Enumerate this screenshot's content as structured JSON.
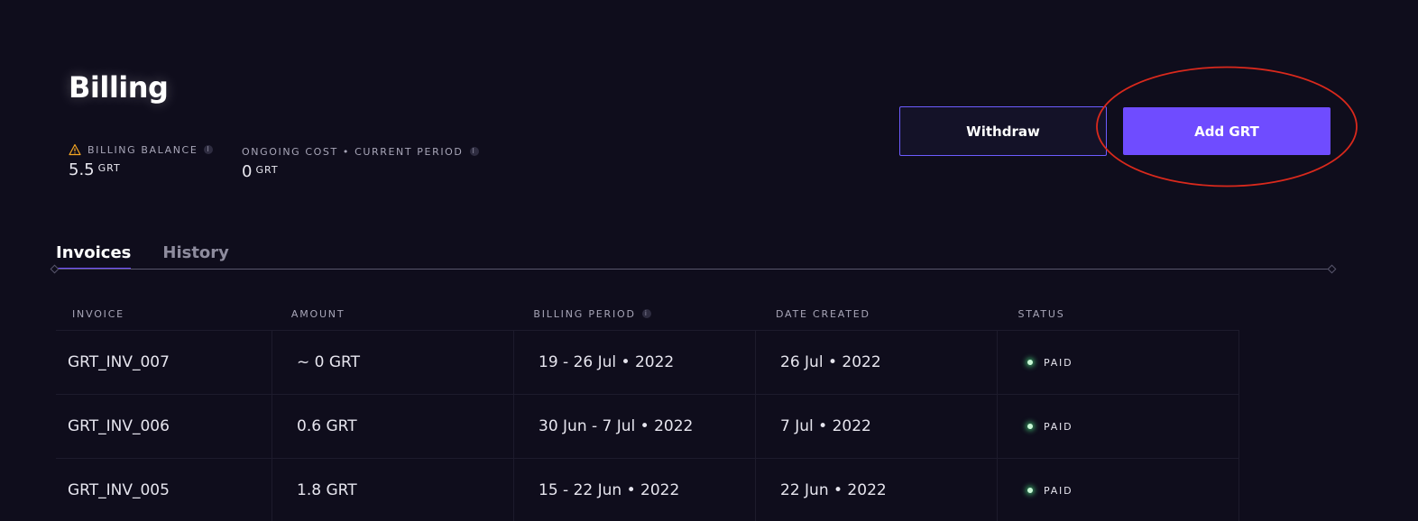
{
  "page": {
    "title": "Billing"
  },
  "stats": {
    "balance": {
      "label": "BILLING BALANCE",
      "value": "5.5",
      "unit": "GRT",
      "icon": "warning-icon"
    },
    "ongoing": {
      "label": "ONGOING COST • CURRENT PERIOD",
      "value": "0",
      "unit": "GRT"
    }
  },
  "actions": {
    "withdraw_label": "Withdraw",
    "add_label": "Add GRT"
  },
  "tabs": [
    {
      "label": "Invoices",
      "active": true
    },
    {
      "label": "History",
      "active": false
    }
  ],
  "table": {
    "headers": [
      "INVOICE",
      "AMOUNT",
      "BILLING PERIOD",
      "DATE CREATED",
      "STATUS"
    ],
    "rows": [
      {
        "invoice": "GRT_INV_007",
        "amount": "~ 0 GRT",
        "period": "19 - 26 Jul • 2022",
        "created": "26 Jul • 2022",
        "status": "PAID"
      },
      {
        "invoice": "GRT_INV_006",
        "amount": "0.6 GRT",
        "period": "30 Jun - 7 Jul • 2022",
        "created": "7 Jul • 2022",
        "status": "PAID"
      },
      {
        "invoice": "GRT_INV_005",
        "amount": "1.8 GRT",
        "period": "15 - 22 Jun • 2022",
        "created": "22 Jun • 2022",
        "status": "PAID"
      }
    ]
  },
  "colors": {
    "background": "#0f0d1c",
    "accent": "#6f4cff",
    "warning": "#f5a623",
    "status_paid": "#4cde80",
    "highlight": "#d9291c"
  }
}
